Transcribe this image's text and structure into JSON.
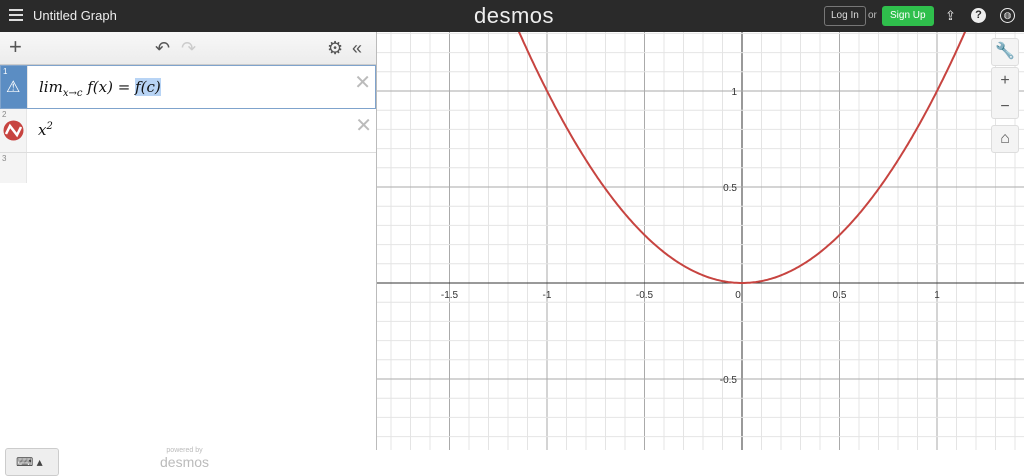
{
  "header": {
    "title": "Untitled Graph",
    "logo": "desmos",
    "login": "Log In",
    "or": "or",
    "signup": "Sign Up",
    "icons": [
      "share-icon",
      "help-icon",
      "globe-icon"
    ],
    "help_glyph": "?"
  },
  "expressions": [
    {
      "index": "1",
      "lim": "lim",
      "sub": "x→c",
      "rest": " f(x) = ",
      "selected": "f(c)",
      "status": "warning-icon"
    },
    {
      "index": "2",
      "base": "x",
      "exp": "2",
      "color": "#c74440"
    },
    {
      "index": "3"
    }
  ],
  "footer": {
    "powered": "powered by",
    "brand": "desmos"
  },
  "graph": {
    "curve_color": "#c74440",
    "function": "x^2",
    "x_ticks": [
      "-1.5",
      "-1",
      "-0.5",
      "0",
      "0.5",
      "1"
    ],
    "y_ticks": [
      "1",
      "0.5",
      "-0.5"
    ],
    "xrange": [
      -1.88,
      1.44
    ],
    "yrange": [
      -0.87,
      1.31
    ]
  }
}
